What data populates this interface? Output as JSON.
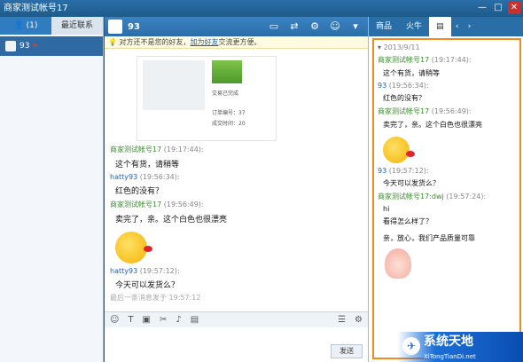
{
  "window": {
    "title": "商家测试帐号17"
  },
  "left": {
    "tabs": [
      {
        "label": "(1)"
      },
      {
        "label": "最近联系"
      }
    ],
    "contacts": [
      {
        "name": "93"
      }
    ]
  },
  "chat": {
    "contact_name": "93",
    "notice_text": "对方还不是您的好友，",
    "notice_link": "加为好友",
    "notice_tail": "交流更方便。",
    "card": {
      "status": "交易已完成",
      "order_label": "订单编号：37",
      "amount_label": "成交时间：20"
    },
    "messages": [
      {
        "from": "商家测试帐号17",
        "time": "(19:17:44):",
        "text": "这个有货，请稍等",
        "role": "seller"
      },
      {
        "from": "hatty93",
        "time": "(19:56:34):",
        "text": "红色的没有？",
        "role": "buyer"
      },
      {
        "from": "商家测试帐号17",
        "time": "(19:56:49):",
        "text": "卖完了，亲。这个白色也很漂亮",
        "role": "seller"
      },
      {
        "from": "hatty93",
        "time": "(19:57:12):",
        "text": "今天可以发货么？",
        "role": "buyer"
      }
    ],
    "last_msg_note": "最后一条消息发于 19:57:12",
    "send_label": "发送"
  },
  "right": {
    "tabs": [
      {
        "label": "商品"
      },
      {
        "label": "火牛"
      },
      {
        "label": "▤"
      }
    ],
    "history_date": "2013/9/11",
    "history": [
      {
        "from": "商家测试帐号17",
        "time": "(19:17:44):",
        "lines": [
          "这个有货，请稍等"
        ],
        "role": "seller"
      },
      {
        "from": "93",
        "time": "(19:56:34):",
        "lines": [
          "红色的没有？"
        ],
        "role": "buyer"
      },
      {
        "from": "商家测试帐号17",
        "time": "(19:56:49):",
        "lines": [
          "卖完了，亲。这个白色也很漂亮"
        ],
        "role": "seller"
      },
      {
        "from": "93",
        "time": "(19:57:12):",
        "lines": [
          "今天可以发货么？"
        ],
        "role": "buyer"
      },
      {
        "from": "商家测试帐号17:dwj",
        "time": "(19:57:24):",
        "lines": [
          "hi",
          "看得怎么样了？",
          "亲，放心，我们产品质量可靠"
        ],
        "role": "seller"
      }
    ]
  },
  "watermark": {
    "name": "系统天地",
    "url": "XiTongTianDi.net"
  }
}
